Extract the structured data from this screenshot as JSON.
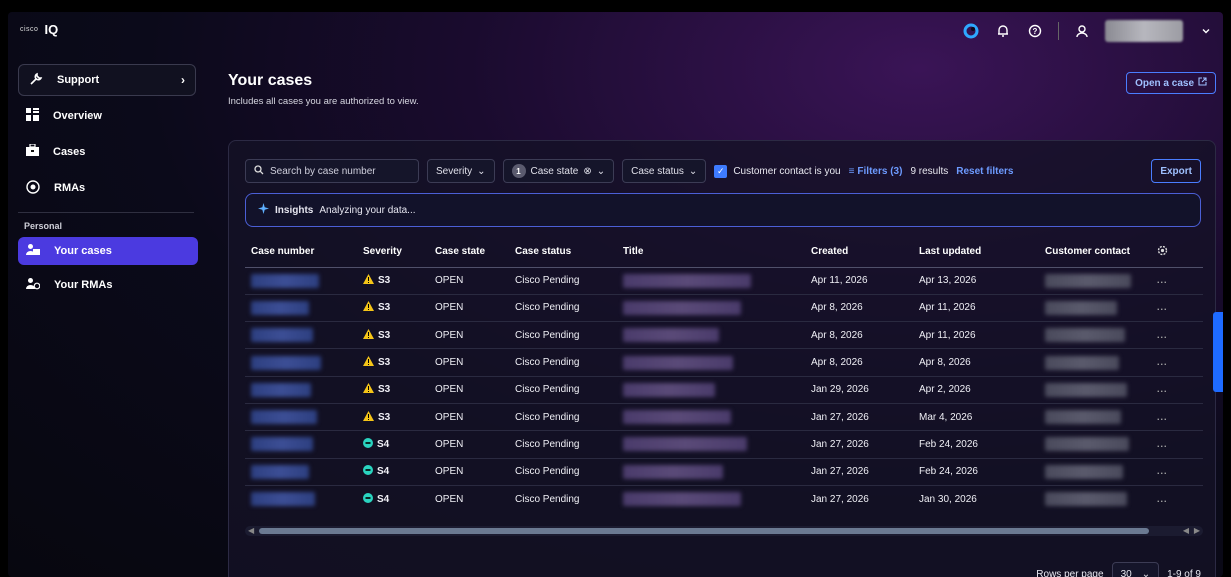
{
  "app": {
    "brand_mark": "cisco",
    "brand_name": "IQ"
  },
  "sidebar": {
    "support_label": "Support",
    "items": [
      {
        "label": "Overview",
        "icon": "grid-icon"
      },
      {
        "label": "Cases",
        "icon": "briefcase-icon"
      },
      {
        "label": "RMAs",
        "icon": "rma-icon"
      }
    ],
    "personal_section": "Personal",
    "personal_items": [
      {
        "label": "Your cases",
        "icon": "user-case-icon",
        "active": true
      },
      {
        "label": "Your RMAs",
        "icon": "user-rma-icon",
        "active": false
      }
    ]
  },
  "header": {
    "title": "Your cases",
    "subtitle": "Includes all cases you are authorized to view.",
    "open_case_label": "Open a case"
  },
  "filters": {
    "search_placeholder": "Search by case number",
    "severity_label": "Severity",
    "case_state_count": "1",
    "case_state_label": "Case state",
    "case_status_label": "Case status",
    "customer_contact_label": "Customer contact is you",
    "filters_link": "Filters (3)",
    "results": "9 results",
    "reset_label": "Reset filters",
    "export_label": "Export"
  },
  "insights": {
    "label": "Insights",
    "text": "Analyzing your data..."
  },
  "table": {
    "columns": [
      "Case number",
      "Severity",
      "Case state",
      "Case status",
      "Title",
      "Created",
      "Last updated",
      "Customer contact"
    ],
    "rows": [
      {
        "severity": "S3",
        "state": "OPEN",
        "status": "Cisco Pending",
        "created": "Apr 11, 2026",
        "updated": "Apr 13, 2026"
      },
      {
        "severity": "S3",
        "state": "OPEN",
        "status": "Cisco Pending",
        "created": "Apr 8, 2026",
        "updated": "Apr 11, 2026"
      },
      {
        "severity": "S3",
        "state": "OPEN",
        "status": "Cisco Pending",
        "created": "Apr 8, 2026",
        "updated": "Apr 11, 2026"
      },
      {
        "severity": "S3",
        "state": "OPEN",
        "status": "Cisco Pending",
        "created": "Apr 8, 2026",
        "updated": "Apr 8, 2026"
      },
      {
        "severity": "S3",
        "state": "OPEN",
        "status": "Cisco Pending",
        "created": "Jan 29, 2026",
        "updated": "Apr 2, 2026"
      },
      {
        "severity": "S3",
        "state": "OPEN",
        "status": "Cisco Pending",
        "created": "Jan 27, 2026",
        "updated": "Mar 4, 2026"
      },
      {
        "severity": "S4",
        "state": "OPEN",
        "status": "Cisco Pending",
        "created": "Jan 27, 2026",
        "updated": "Feb 24, 2026"
      },
      {
        "severity": "S4",
        "state": "OPEN",
        "status": "Cisco Pending",
        "created": "Jan 27, 2026",
        "updated": "Feb 24, 2026"
      },
      {
        "severity": "S4",
        "state": "OPEN",
        "status": "Cisco Pending",
        "created": "Jan 27, 2026",
        "updated": "Jan 30, 2026"
      }
    ],
    "more_label": "..."
  },
  "pager": {
    "rows_per_page_label": "Rows per page",
    "rows_per_page": "30",
    "range": "1-9 of 9"
  },
  "colors": {
    "accent": "#4b3ae0",
    "link": "#6d9bff",
    "sev3": "#f5c518",
    "sev4": "#2ad4c0"
  }
}
